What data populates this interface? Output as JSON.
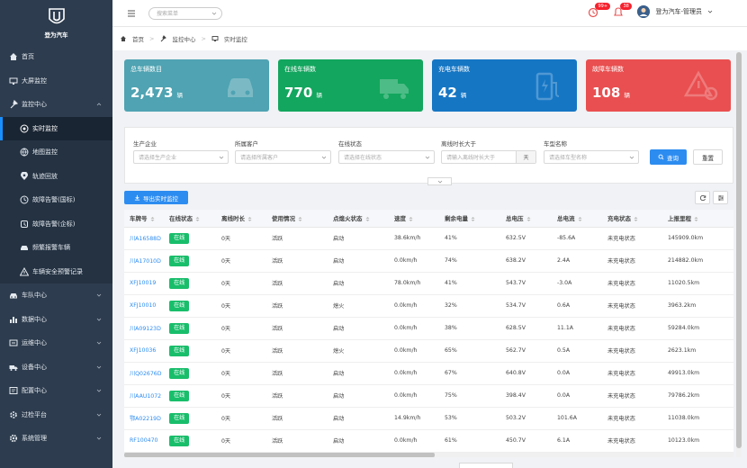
{
  "sidebar": {
    "logo_text": "登为汽车",
    "items": [
      {
        "label": "首页",
        "icon": "home-icon"
      },
      {
        "label": "大屏监控",
        "icon": "monitor-icon"
      },
      {
        "label": "监控中心",
        "icon": "wrench-icon"
      },
      {
        "label": "实时监控",
        "icon": "circle-dot-icon"
      },
      {
        "label": "地图监控",
        "icon": "globe-icon"
      },
      {
        "label": "轨迹回放",
        "icon": "location-pin-icon"
      },
      {
        "label": "故障告警(国标)",
        "icon": "clock-icon"
      },
      {
        "label": "故障告警(企标)",
        "icon": "alarm-icon"
      },
      {
        "label": "频繁报警车辆",
        "icon": "car-alert-icon"
      },
      {
        "label": "车辆安全预警记录",
        "icon": "warning-icon"
      },
      {
        "label": "车队中心",
        "icon": "car-icon"
      },
      {
        "label": "数据中心",
        "icon": "bar-chart-icon"
      },
      {
        "label": "运维中心",
        "icon": "tools-icon"
      },
      {
        "label": "设备中心",
        "icon": "truck-icon"
      },
      {
        "label": "配置中心",
        "icon": "config-icon"
      },
      {
        "label": "过检平台",
        "icon": "check-icon"
      },
      {
        "label": "系统管理",
        "icon": "gear-icon"
      }
    ]
  },
  "header": {
    "search_placeholder": "搜索菜单",
    "badge_clock": "99+",
    "badge_bell": "38",
    "user_name": "登为汽车-管理员"
  },
  "breadcrumb": {
    "home": "首页",
    "level1": "监控中心",
    "level2": "实时监控"
  },
  "stats": [
    {
      "title": "总车辆数目",
      "value": "2,473",
      "unit": "辆",
      "color": "#4fa3b2"
    },
    {
      "title": "在线车辆数",
      "value": "770",
      "unit": "辆",
      "color": "#13a65e"
    },
    {
      "title": "充电车辆数",
      "value": "42",
      "unit": "辆",
      "color": "#1576c4"
    },
    {
      "title": "故障车辆数",
      "value": "108",
      "unit": "辆",
      "color": "#e94f50"
    }
  ],
  "filters": [
    {
      "label": "生产企业",
      "placeholder": "请选择生产企业"
    },
    {
      "label": "所属客户",
      "placeholder": "请选择所属客户"
    },
    {
      "label": "在线状态",
      "placeholder": "请选择在线状态"
    },
    {
      "label": "离线时长大于",
      "placeholder": "请输入离线时长大于",
      "suffix": "天"
    },
    {
      "label": "车型名称",
      "placeholder": "请选择车型名称"
    }
  ],
  "buttons": {
    "query": "查询",
    "reset": "重置",
    "export": "导出实时监控"
  },
  "table": {
    "headers": [
      "车牌号",
      "在线状态",
      "离线时长",
      "使用情况",
      "点熄火状态",
      "速度",
      "剩余电量",
      "总电压",
      "总电流",
      "充电状态",
      "上报里程"
    ],
    "rows": [
      [
        "川A16588D",
        "在线",
        "0天",
        "活跃",
        "启动",
        "38.6km/h",
        "41%",
        "632.5V",
        "-85.6A",
        "未充电状态",
        "145909.0km"
      ],
      [
        "川A17010D",
        "在线",
        "0天",
        "活跃",
        "启动",
        "0.0km/h",
        "74%",
        "638.2V",
        "2.4A",
        "未充电状态",
        "214882.0km"
      ],
      [
        "XFJ10019",
        "在线",
        "0天",
        "活跃",
        "启动",
        "78.0km/h",
        "41%",
        "543.7V",
        "-3.0A",
        "未充电状态",
        "11020.5km"
      ],
      [
        "XFJ10010",
        "在线",
        "0天",
        "活跃",
        "熄火",
        "0.0km/h",
        "32%",
        "534.7V",
        "0.6A",
        "未充电状态",
        "3963.2km"
      ],
      [
        "川A09123D",
        "在线",
        "0天",
        "活跃",
        "启动",
        "0.0km/h",
        "38%",
        "628.5V",
        "11.1A",
        "未充电状态",
        "59284.0km"
      ],
      [
        "XFJ10036",
        "在线",
        "0天",
        "活跃",
        "熄火",
        "0.0km/h",
        "65%",
        "562.7V",
        "0.5A",
        "未充电状态",
        "2623.1km"
      ],
      [
        "川Q02676D",
        "在线",
        "0天",
        "活跃",
        "启动",
        "0.0km/h",
        "67%",
        "640.8V",
        "0.0A",
        "未充电状态",
        "49913.0km"
      ],
      [
        "川AAU1072",
        "在线",
        "0天",
        "活跃",
        "启动",
        "0.0km/h",
        "75%",
        "398.4V",
        "0.0A",
        "未充电状态",
        "79786.2km"
      ],
      [
        "鄂A02219D",
        "在线",
        "0天",
        "活跃",
        "启动",
        "14.9km/h",
        "53%",
        "503.2V",
        "101.6A",
        "未充电状态",
        "11038.0km"
      ],
      [
        "RF100470",
        "在线",
        "0天",
        "活跃",
        "启动",
        "0.0km/h",
        "61%",
        "450.7V",
        "6.1A",
        "未充电状态",
        "10123.0km"
      ]
    ]
  }
}
